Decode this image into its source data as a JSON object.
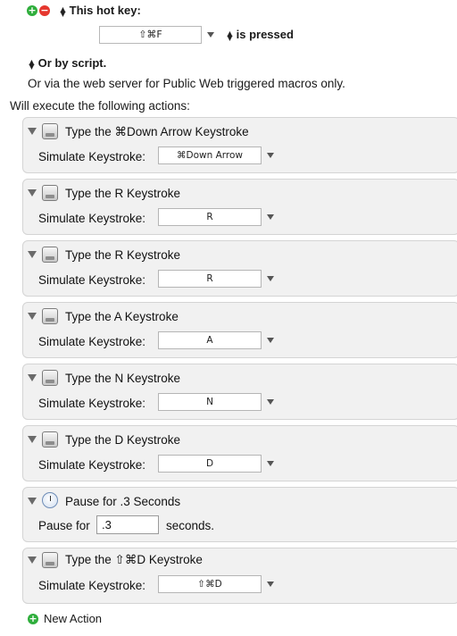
{
  "trigger": {
    "hotkey_label": "This hot key:",
    "hotkey_value": "⇧⌘F",
    "pressed_label": "is pressed",
    "script_label": "Or by script.",
    "web_server_text": "Or via the web server for Public Web triggered macros only."
  },
  "actions_header": "Will execute the following actions:",
  "actions": [
    {
      "title": "Type the ⌘Down Arrow Keystroke",
      "field_label": "Simulate Keystroke:",
      "value": "⌘Down Arrow"
    },
    {
      "title": "Type the R Keystroke",
      "field_label": "Simulate Keystroke:",
      "value": "R"
    },
    {
      "title": "Type the R Keystroke",
      "field_label": "Simulate Keystroke:",
      "value": "R"
    },
    {
      "title": "Type the A Keystroke",
      "field_label": "Simulate Keystroke:",
      "value": "A"
    },
    {
      "title": "Type the N Keystroke",
      "field_label": "Simulate Keystroke:",
      "value": "N"
    },
    {
      "title": "Type the D Keystroke",
      "field_label": "Simulate Keystroke:",
      "value": "D"
    }
  ],
  "pause_action": {
    "title": "Pause for .3 Seconds",
    "field_label": "Pause for",
    "value": ".3",
    "unit_label": "seconds."
  },
  "last_action": {
    "title": "Type the ⇧⌘D Keystroke",
    "field_label": "Simulate Keystroke:",
    "value": "⇧⌘D"
  },
  "new_action_label": "New Action",
  "icons": {
    "add": "plus-circle-icon",
    "remove": "minus-circle-icon",
    "keystroke": "keyboard-icon",
    "pause": "clock-icon",
    "disclosure": "disclosure-triangle-icon",
    "popup": "popup-arrow-icon"
  },
  "colors": {
    "add_green": "#2fae3c",
    "remove_red": "#e5372e",
    "action_bg": "#f1f1f1",
    "action_border": "#d4d4d4"
  }
}
